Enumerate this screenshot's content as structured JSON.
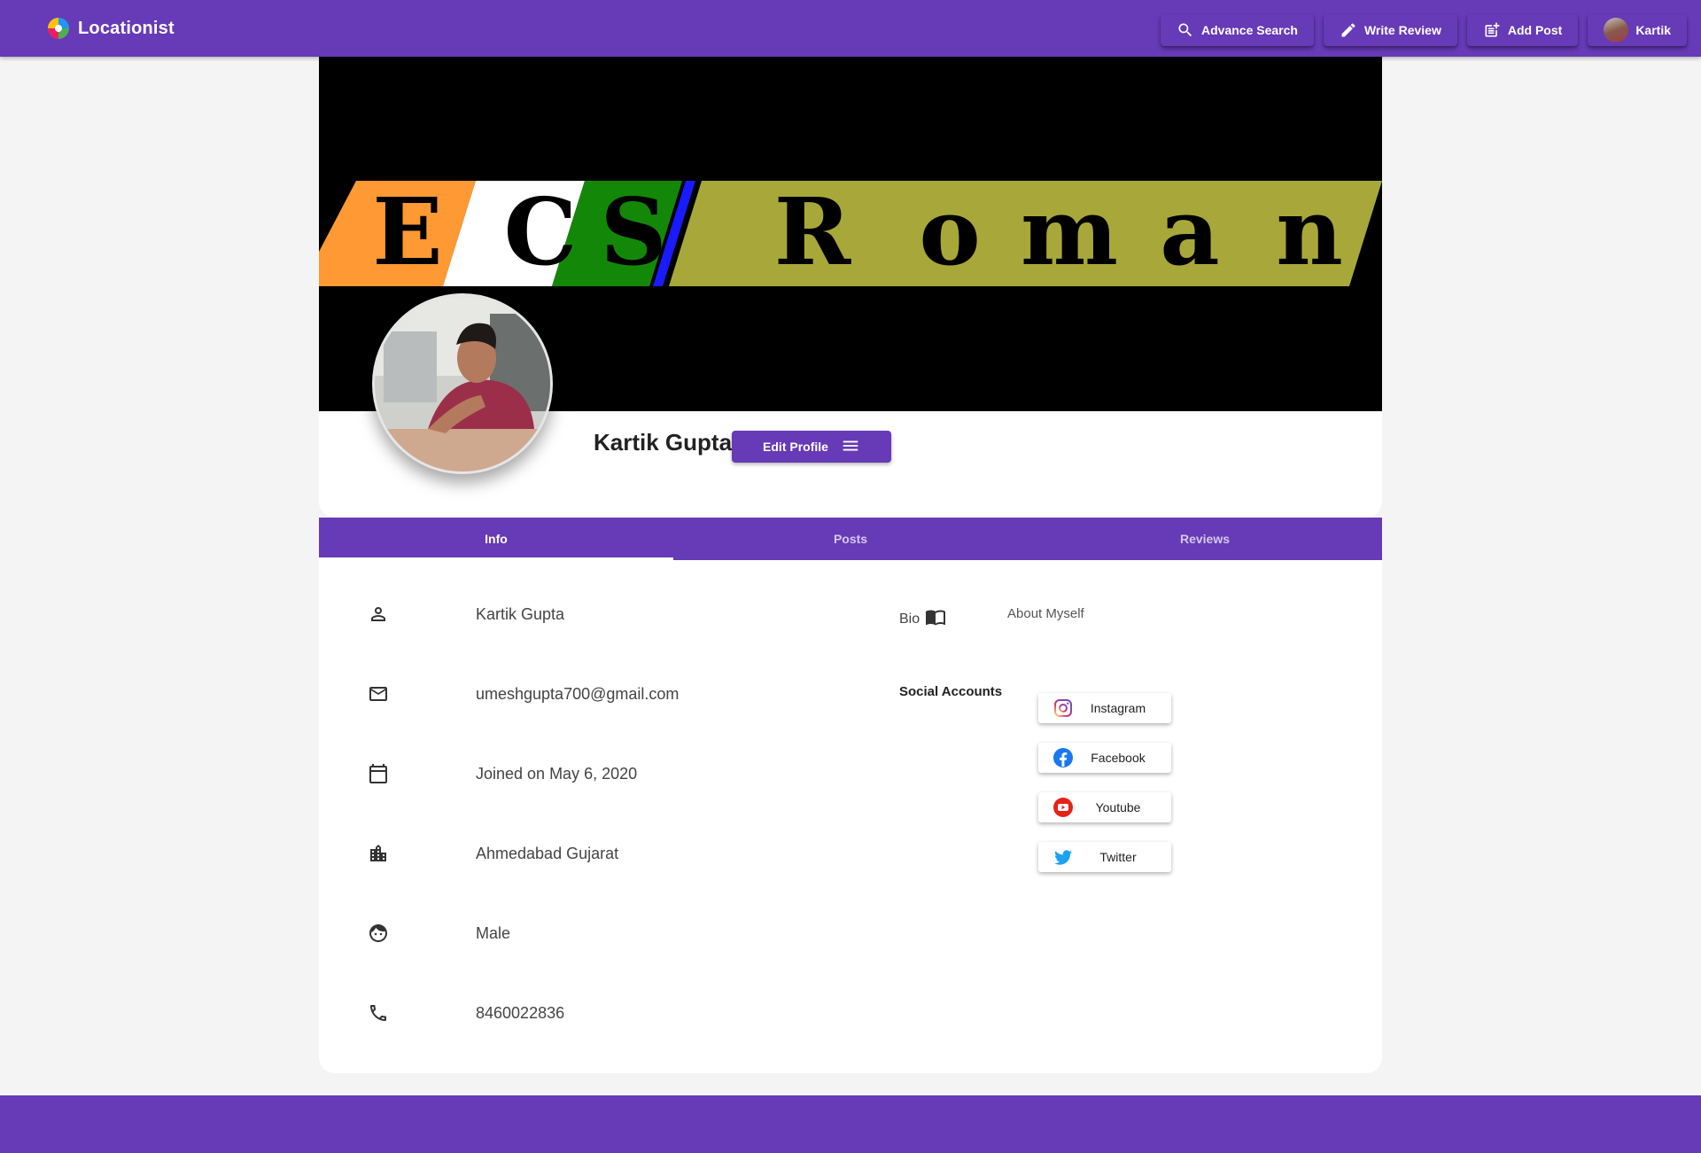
{
  "app": {
    "name": "Locationist"
  },
  "nav": {
    "advance_search": "Advance Search",
    "write_review": "Write Review",
    "add_post": "Add Post",
    "user": "Kartik"
  },
  "cover": {
    "text": "ECS Roman",
    "letters": [
      "E",
      "C",
      "S",
      "R",
      "o",
      "m",
      "a",
      "n"
    ]
  },
  "profile": {
    "name": "Kartik Gupta",
    "edit_label": "Edit Profile"
  },
  "tabs": [
    {
      "label": "Info",
      "active": true
    },
    {
      "label": "Posts",
      "active": false
    },
    {
      "label": "Reviews",
      "active": false
    }
  ],
  "info": {
    "name": "Kartik Gupta",
    "email": "umeshgupta700@gmail.com",
    "joined": "Joined on May 6, 2020",
    "location": "Ahmedabad Gujarat",
    "gender": "Male",
    "phone": "8460022836"
  },
  "bio": {
    "label": "Bio",
    "text": "About Myself"
  },
  "social": {
    "title": "Social Accounts",
    "accounts": [
      {
        "label": "Instagram",
        "icon": "instagram-icon"
      },
      {
        "label": "Facebook",
        "icon": "facebook-icon"
      },
      {
        "label": "Youtube",
        "icon": "youtube-icon"
      },
      {
        "label": "Twitter",
        "icon": "twitter-icon"
      }
    ]
  },
  "colors": {
    "primary": "#673ab7",
    "background": "#f4f4f4"
  }
}
